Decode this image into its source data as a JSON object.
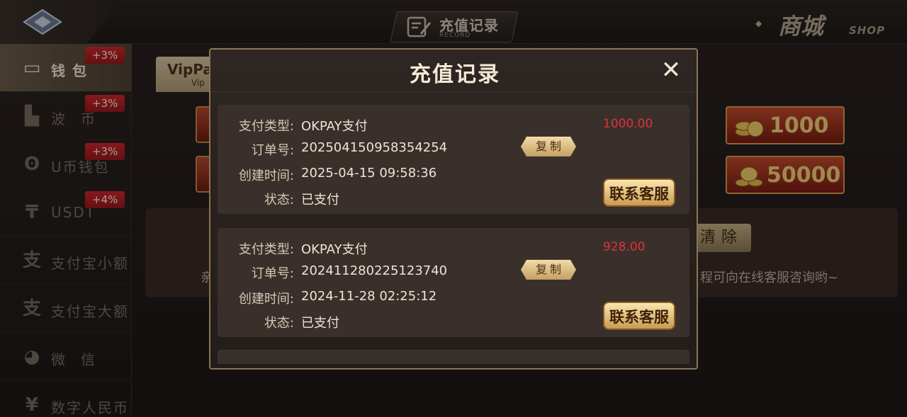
{
  "header": {
    "title_cn": "充值记录",
    "title_en": "RECORD",
    "shop_cn": "商城",
    "shop_en": "SHOP"
  },
  "sidebar": {
    "items": [
      {
        "label": "钱包",
        "badge": "+3%",
        "icon": "wallet-icon",
        "active": true
      },
      {
        "label": "波币",
        "badge": "+3%",
        "icon": "bobi-icon",
        "active": false
      },
      {
        "label": "U币钱包",
        "badge": "+3%",
        "icon": "ucoin-icon",
        "active": false
      },
      {
        "label": "USDT",
        "badge": "+4%",
        "icon": "usdt-icon",
        "active": false
      },
      {
        "label": "支付宝小额",
        "badge": "",
        "icon": "alipay-icon",
        "active": false
      },
      {
        "label": "支付宝大额",
        "badge": "",
        "icon": "alipay-icon",
        "active": false
      },
      {
        "label": "微信",
        "badge": "",
        "icon": "wechat-icon",
        "active": false
      },
      {
        "label": "数字人民币",
        "badge": "",
        "icon": "digital-rmb-icon",
        "active": false
      }
    ]
  },
  "background": {
    "tab_label": "VipPa",
    "tab_sub": "Vip",
    "coin_buttons": [
      "1000",
      "50000"
    ],
    "clear_label": "清除",
    "hint_fragment": "程可向在线客服咨询哟~",
    "left_fragment": "亲"
  },
  "modal": {
    "title": "充值记录",
    "close_label": "✕",
    "labels": {
      "pay_type": "支付类型:",
      "order_no": "订单号:",
      "created": "创建时间:",
      "status": "状态:"
    },
    "copy_label": "复制",
    "service_label": "联系客服",
    "records": [
      {
        "pay_type": "OKPAY支付",
        "order_no": "202504150958354254",
        "created": "2025-04-15 09:58:36",
        "status": "已支付",
        "amount": "1000.00"
      },
      {
        "pay_type": "OKPAY支付",
        "order_no": "202411280225123740",
        "created": "2024-11-28 02:25:12",
        "status": "已支付",
        "amount": "928.00"
      }
    ]
  },
  "colors": {
    "accent_gold": "#c99b55",
    "amount_red": "#e0303a",
    "badge_red": "#d0262b"
  }
}
